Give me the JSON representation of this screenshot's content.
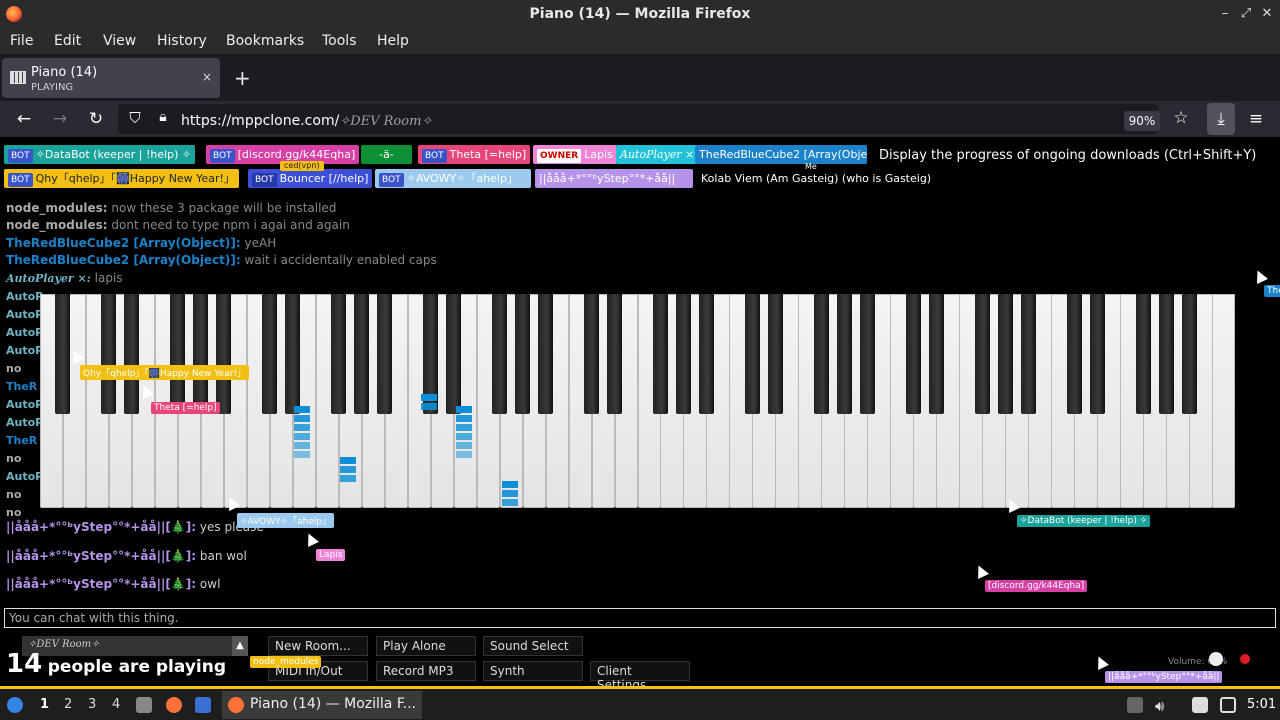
{
  "window": {
    "title": "Piano (14) — Mozilla Firefox"
  },
  "menu": [
    "File",
    "Edit",
    "View",
    "History",
    "Bookmarks",
    "Tools",
    "Help"
  ],
  "tab": {
    "title": "Piano (14)",
    "status": "PLAYING",
    "close": "×",
    "new": "+"
  },
  "nav": {
    "url_host": "https://mppclone.com/",
    "url_room": "✧DEV Room✧",
    "zoom": "90%"
  },
  "tooltip": "Display the progress of ongoing downloads (Ctrl+Shift+Y)",
  "users": {
    "databot": "✧DataBot (keeper | !help) ✧",
    "discord": "[discord.gg/k44Eqha]",
    "dash": "-ä-",
    "theta": "Theta [=help]",
    "lapis": "Lapis",
    "autoplayer": "AutoPlayer ×",
    "redblue": "TheRedBlueCube2 [Array(Obje",
    "qhy": "Qhy「qhelp」「🎆Happy New Year!」",
    "bouncer": "Bouncer [//help]",
    "avowy": "✧AVOWY✧「ahelp」",
    "fancy": "||ååå+*°°ᵇyStep°°*+åå||",
    "kolab": "Kolab Viem (Am Gasteig) (who is Gasteig)",
    "bot_badge": "BOT",
    "owner_badge": "OWNER",
    "vpn": "ced(vpn)",
    "me": "Me"
  },
  "chat": [
    {
      "name": "node_modules:",
      "msg": "now these 3 package will be installed"
    },
    {
      "name": "node_modules:",
      "msg": "dont need to type npm i agai and again"
    },
    {
      "name": "TheRedBlueCube2 [Array(Object)]:",
      "msg": "yeAH"
    },
    {
      "name": "TheRedBlueCube2 [Array(Object)]:",
      "msg": "wait i accidentally enabled caps"
    },
    {
      "name": "AutoPlayer ×:",
      "msg": "lapis"
    }
  ],
  "chat2": [
    {
      "name": "||ååå+*°°ᵇyStep°°*+åå||[🎄]:",
      "msg": "yes please"
    },
    {
      "name": "||ååå+*°°ᵇyStep°°*+åå||[🎄]:",
      "msg": "ban wol"
    },
    {
      "name": "||ååå+*°°ᵇyStep°°*+åå||[🎄]:",
      "msg": "owl"
    }
  ],
  "side_names": [
    "AutoP",
    "AutoP",
    "AutoP",
    "AutoP",
    "no",
    "TheR",
    "AutoP",
    "AutoP",
    "TheR",
    "no",
    "AutoP",
    "no",
    "no"
  ],
  "cursor_labels": {
    "qhy": "Qhy「qhelp」「🎆Happy New Year!」",
    "theta": "Theta [=help]",
    "avowy": "✧AVOWY✧「ahelp」",
    "lapis": "Lapis",
    "databot": "✧DataBot (keeper | !help) ✧",
    "discord": "[discord.gg/k44Eqha]",
    "node": "node_modules",
    "fancy": "||ååå+*°°ᵇyStep°°*+åå||",
    "edge": "The"
  },
  "chat_input": {
    "placeholder": "You can chat with this thing."
  },
  "controls": {
    "room": "✧DEV Room✧",
    "new_room": "New Room...",
    "play_alone": "Play Alone",
    "sound_select": "Sound Select",
    "midi": "MIDI In/Out",
    "record": "Record MP3",
    "synth": "Synth",
    "client_settings": "Client Settings"
  },
  "playing": {
    "count": "14",
    "text": "people are playing"
  },
  "volume": "Volume: 60%",
  "taskbar": {
    "workspaces": [
      "1",
      "2",
      "3",
      "4"
    ],
    "task": "Piano (14) — Mozilla F...",
    "clock": "5:01"
  },
  "colors": {
    "databot": "#1aa39a",
    "discord": "#d63fa3",
    "dash": "#0d8f35",
    "theta": "#e8467a",
    "lapis": "#ef85d9",
    "autoplayer": "#22c3d9",
    "redblue": "#1b82c9",
    "qhy": "#f2c012",
    "bouncer": "#3c4fd6",
    "avowy": "#9cc9ee",
    "fancy": "#b493e8",
    "note": "#0c8fd6",
    "taskbar_accent": "#f5c211"
  }
}
